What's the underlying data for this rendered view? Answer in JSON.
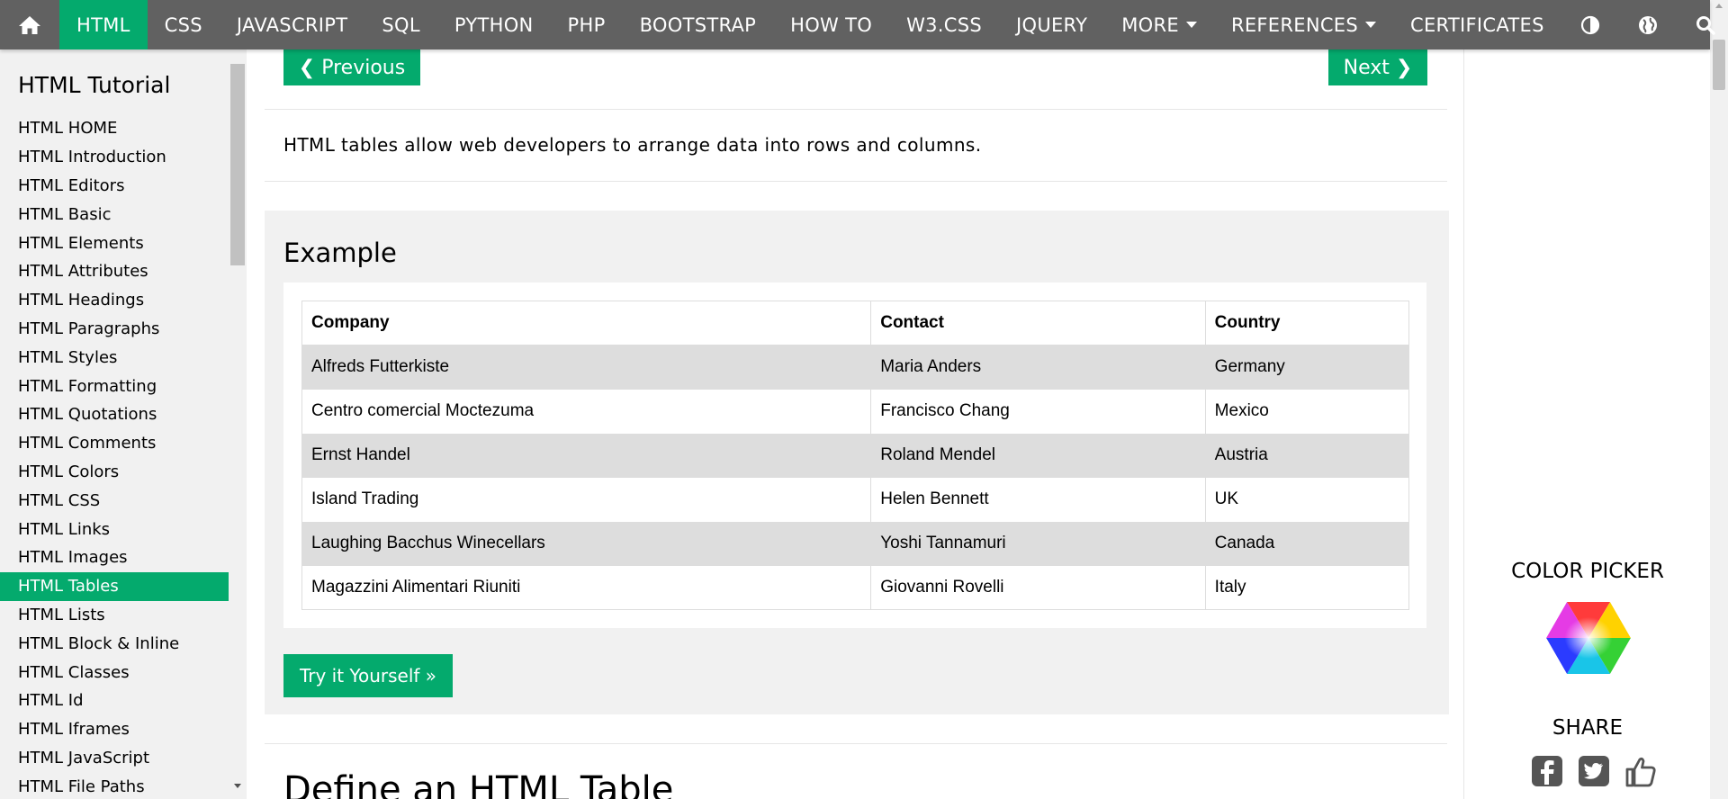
{
  "topnav": {
    "items": [
      "HTML",
      "CSS",
      "JAVASCRIPT",
      "SQL",
      "PYTHON",
      "PHP",
      "BOOTSTRAP",
      "HOW TO",
      "W3.CSS",
      "JQUERY"
    ],
    "more_label": "MORE",
    "references_label": "REFERENCES",
    "certificates_label": "CERTIFICATES",
    "icons": [
      "home-icon",
      "contrast-icon",
      "globe-icon",
      "search-icon"
    ]
  },
  "sidebar": {
    "title": "HTML Tutorial",
    "items": [
      {
        "label": "HTML HOME"
      },
      {
        "label": "HTML Introduction"
      },
      {
        "label": "HTML Editors"
      },
      {
        "label": "HTML Basic"
      },
      {
        "label": "HTML Elements"
      },
      {
        "label": "HTML Attributes"
      },
      {
        "label": "HTML Headings"
      },
      {
        "label": "HTML Paragraphs"
      },
      {
        "label": "HTML Styles"
      },
      {
        "label": "HTML Formatting"
      },
      {
        "label": "HTML Quotations"
      },
      {
        "label": "HTML Comments"
      },
      {
        "label": "HTML Colors"
      },
      {
        "label": "HTML CSS"
      },
      {
        "label": "HTML Links"
      },
      {
        "label": "HTML Images"
      },
      {
        "label": "HTML Tables",
        "active": true
      },
      {
        "label": "HTML Lists"
      },
      {
        "label": "HTML Block & Inline"
      },
      {
        "label": "HTML Classes"
      },
      {
        "label": "HTML Id"
      },
      {
        "label": "HTML Iframes"
      },
      {
        "label": "HTML JavaScript"
      },
      {
        "label": "HTML File Paths"
      }
    ]
  },
  "main": {
    "prev_label": "❮ Previous",
    "next_label": "Next ❯",
    "intro": "HTML tables allow web developers to arrange data into rows and columns.",
    "example": {
      "title": "Example",
      "table": {
        "headers": [
          "Company",
          "Contact",
          "Country"
        ],
        "rows": [
          [
            "Alfreds Futterkiste",
            "Maria Anders",
            "Germany"
          ],
          [
            "Centro comercial Moctezuma",
            "Francisco Chang",
            "Mexico"
          ],
          [
            "Ernst Handel",
            "Roland Mendel",
            "Austria"
          ],
          [
            "Island Trading",
            "Helen Bennett",
            "UK"
          ],
          [
            "Laughing Bacchus Winecellars",
            "Yoshi Tannamuri",
            "Canada"
          ],
          [
            "Magazzini Alimentari Riuniti",
            "Giovanni Rovelli",
            "Italy"
          ]
        ]
      },
      "try_label": "Try it Yourself »"
    },
    "next_heading": "Define an HTML Table"
  },
  "rightcol": {
    "color_picker_title": "COLOR PICKER",
    "share_title": "SHARE",
    "share_icons": [
      "facebook-icon",
      "twitter-icon",
      "like-icon"
    ]
  },
  "colors": {
    "nav_bg": "#616161",
    "accent_green": "#04AA6D",
    "sidebar_bg": "#f1f1f1",
    "table_alt_row": "#dddddd"
  }
}
